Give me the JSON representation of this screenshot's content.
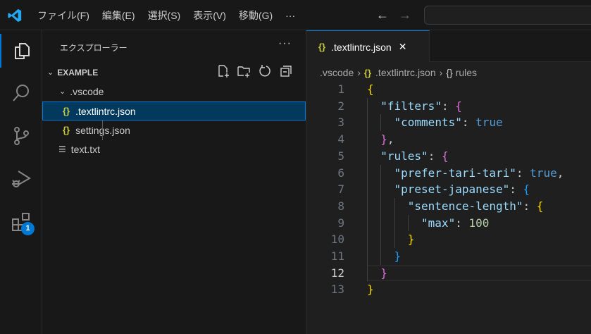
{
  "menu": [
    "ファイル(F)",
    "編集(E)",
    "選択(S)",
    "表示(V)",
    "移動(G)",
    "···"
  ],
  "explorer": {
    "title": "エクスプローラー",
    "more": "···",
    "root": "EXAMPLE",
    "items": [
      {
        "label": ".vscode",
        "type": "folder"
      },
      {
        "label": ".textlintrc.json",
        "type": "json",
        "selected": true
      },
      {
        "label": "settings.json",
        "type": "json"
      },
      {
        "label": "text.txt",
        "type": "text"
      }
    ]
  },
  "extensions_badge": "1",
  "tab": {
    "label": ".textlintrc.json",
    "close": "✕",
    "icon": "{}"
  },
  "breadcrumb": [
    ".vscode",
    "›",
    "{}",
    ".textlintrc.json",
    "›",
    "{}",
    "rules"
  ],
  "colors": {
    "key": "#9cdcfe",
    "bool": "#569cd6",
    "num": "#b5cea8",
    "p": "#cccccc",
    "b1": "#ffd700",
    "b2": "#da70d6",
    "b3": "#179fff"
  },
  "current_line": 12,
  "code": [
    {
      "indent": 0,
      "tokens": [
        [
          "{",
          "b1"
        ]
      ]
    },
    {
      "indent": 1,
      "tokens": [
        [
          "\"filters\"",
          "key"
        ],
        [
          ": ",
          "p"
        ],
        [
          "{",
          "b2"
        ]
      ]
    },
    {
      "indent": 2,
      "tokens": [
        [
          "\"comments\"",
          "key"
        ],
        [
          ": ",
          "p"
        ],
        [
          "true",
          "bool"
        ]
      ]
    },
    {
      "indent": 1,
      "tokens": [
        [
          "}",
          "b2"
        ],
        [
          ",",
          "p"
        ]
      ]
    },
    {
      "indent": 1,
      "tokens": [
        [
          "\"rules\"",
          "key"
        ],
        [
          ": ",
          "p"
        ],
        [
          "{",
          "b2"
        ]
      ]
    },
    {
      "indent": 2,
      "tokens": [
        [
          "\"prefer-tari-tari\"",
          "key"
        ],
        [
          ": ",
          "p"
        ],
        [
          "true",
          "bool"
        ],
        [
          ",",
          "p"
        ]
      ]
    },
    {
      "indent": 2,
      "tokens": [
        [
          "\"preset-japanese\"",
          "key"
        ],
        [
          ": ",
          "p"
        ],
        [
          "{",
          "b3"
        ]
      ]
    },
    {
      "indent": 3,
      "tokens": [
        [
          "\"sentence-length\"",
          "key"
        ],
        [
          ": ",
          "p"
        ],
        [
          "{",
          "b1"
        ]
      ]
    },
    {
      "indent": 4,
      "tokens": [
        [
          "\"max\"",
          "key"
        ],
        [
          ": ",
          "p"
        ],
        [
          "100",
          "num"
        ]
      ]
    },
    {
      "indent": 3,
      "tokens": [
        [
          "}",
          "b1"
        ]
      ]
    },
    {
      "indent": 2,
      "tokens": [
        [
          "}",
          "b3"
        ]
      ]
    },
    {
      "indent": 1,
      "tokens": [
        [
          "}",
          "b2"
        ]
      ]
    },
    {
      "indent": 0,
      "tokens": [
        [
          "}",
          "b1"
        ]
      ]
    }
  ]
}
